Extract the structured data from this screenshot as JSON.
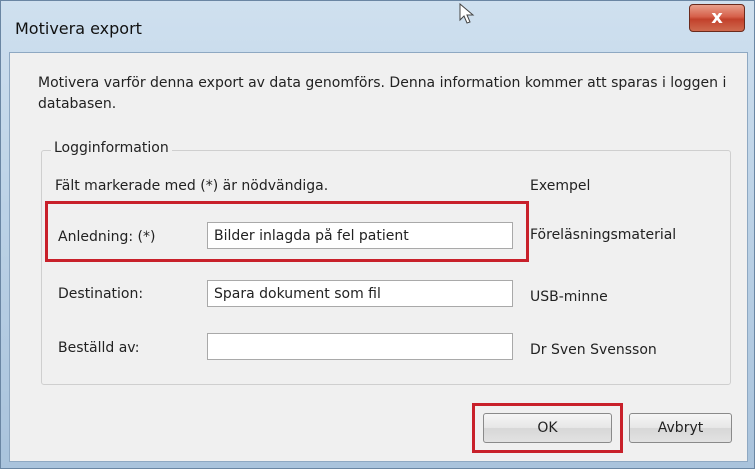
{
  "window": {
    "title": "Motivera export",
    "close_symbol": "x"
  },
  "intro": "Motivera varför denna export av data genomförs. Denna information kommer att sparas i loggen i databasen.",
  "group": {
    "legend": "Logginformation",
    "required_note": "Fält markerade med (*) är nödvändiga.",
    "example_header": "Exempel",
    "fields": [
      {
        "label": "Anledning: (*)",
        "value": "Bilder inlagda på fel patient",
        "example": "Föreläsningsmaterial"
      },
      {
        "label": "Destination:",
        "value": "Spara dokument som fil",
        "example": "USB-minne"
      },
      {
        "label": "Beställd av:",
        "value": "",
        "example": "Dr Sven Svensson"
      }
    ]
  },
  "buttons": {
    "ok": "OK",
    "cancel": "Avbryt"
  },
  "colors": {
    "highlight": "#c8202a",
    "close_button": "#c2412b",
    "title_gradient": "#bcd2e6"
  },
  "icons": [
    "cursor-icon",
    "close-icon"
  ]
}
